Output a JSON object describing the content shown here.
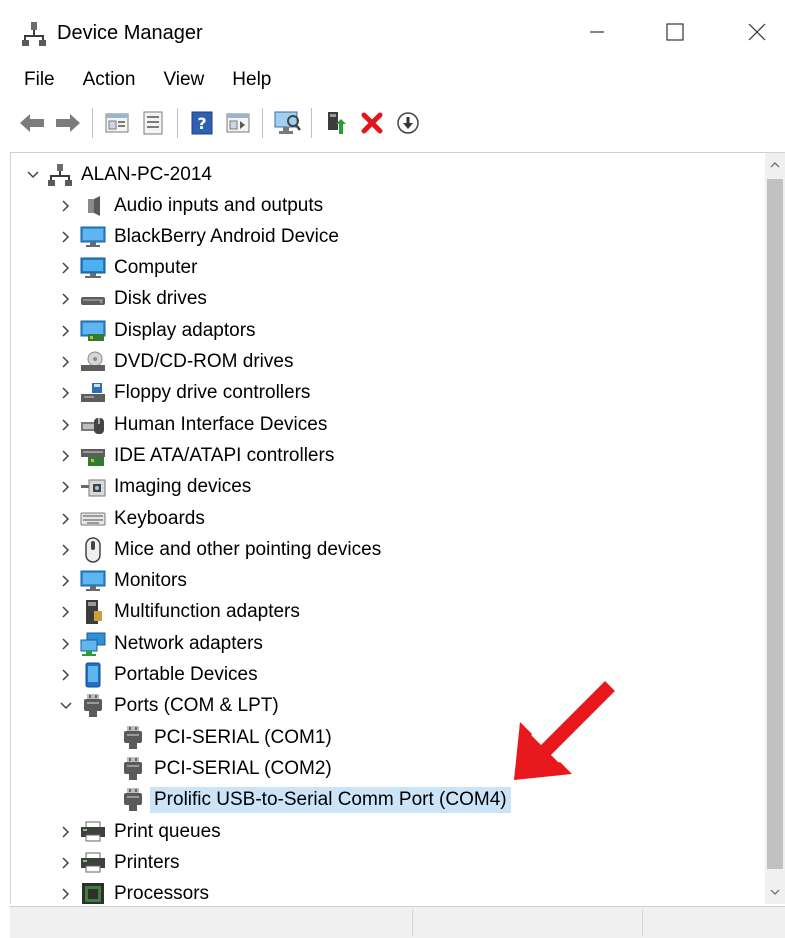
{
  "window": {
    "title": "Device Manager",
    "controls": {
      "minimize": "—",
      "maximize": "☐",
      "close": "✕"
    }
  },
  "menu": [
    "File",
    "Action",
    "View",
    "Help"
  ],
  "toolbar": {
    "buttons": [
      "back-icon",
      "forward-icon",
      "properties-icon",
      "update-icon",
      "help-icon",
      "view-icon",
      "scan-icon",
      "enable-device-icon",
      "uninstall-icon",
      "download-icon"
    ]
  },
  "tree": {
    "root": "ALAN-PC-2014",
    "items": [
      {
        "label": "Audio inputs and outputs",
        "icon": "speaker-icon",
        "expanded": false
      },
      {
        "label": "BlackBerry Android Device",
        "icon": "monitor-icon",
        "expanded": false
      },
      {
        "label": "Computer",
        "icon": "computer-icon",
        "expanded": false
      },
      {
        "label": "Disk drives",
        "icon": "disk-icon",
        "expanded": false
      },
      {
        "label": "Display adaptors",
        "icon": "display-adapter-icon",
        "expanded": false
      },
      {
        "label": "DVD/CD-ROM drives",
        "icon": "dvd-icon",
        "expanded": false
      },
      {
        "label": "Floppy drive controllers",
        "icon": "floppy-icon",
        "expanded": false
      },
      {
        "label": "Human Interface Devices",
        "icon": "hid-icon",
        "expanded": false
      },
      {
        "label": "IDE ATA/ATAPI controllers",
        "icon": "ide-icon",
        "expanded": false
      },
      {
        "label": "Imaging devices",
        "icon": "camera-icon",
        "expanded": false
      },
      {
        "label": "Keyboards",
        "icon": "keyboard-icon",
        "expanded": false
      },
      {
        "label": "Mice and other pointing devices",
        "icon": "mouse-icon",
        "expanded": false
      },
      {
        "label": "Monitors",
        "icon": "monitor-icon",
        "expanded": false
      },
      {
        "label": "Multifunction adapters",
        "icon": "multifunction-icon",
        "expanded": false
      },
      {
        "label": "Network adapters",
        "icon": "network-icon",
        "expanded": false
      },
      {
        "label": "Portable Devices",
        "icon": "portable-icon",
        "expanded": false
      },
      {
        "label": "Ports (COM & LPT)",
        "icon": "port-icon",
        "expanded": true
      },
      {
        "label": "PCI-SERIAL (COM1)",
        "icon": "port-icon",
        "child": true
      },
      {
        "label": "PCI-SERIAL (COM2)",
        "icon": "port-icon",
        "child": true
      },
      {
        "label": "Prolific USB-to-Serial Comm Port (COM4)",
        "icon": "port-icon",
        "child": true,
        "selected": true
      },
      {
        "label": "Print queues",
        "icon": "printer-icon",
        "expanded": false
      },
      {
        "label": "Printers",
        "icon": "printer-icon",
        "expanded": false
      },
      {
        "label": "Processors",
        "icon": "processor-icon",
        "expanded": false
      }
    ]
  },
  "colors": {
    "selection": "#cce4f7",
    "annotation_arrow": "#e8191d"
  }
}
